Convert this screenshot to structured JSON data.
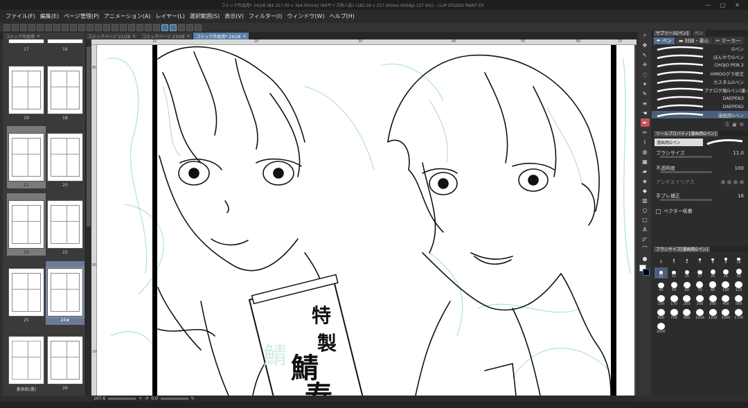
{
  "window": {
    "title": "コミック作品用* 24/28 (B4 257.00 x 364.00mm) (B4サイズ同人誌) (182.00 x 257.00mm 600dpi 107.6%) - CLIP STUDIO PAINT EX",
    "controls": [
      "—",
      "□",
      "✕"
    ]
  },
  "menu": [
    "ファイル(F)",
    "編集(E)",
    "ページ管理(P)",
    "アニメーション(A)",
    "レイヤー(L)",
    "選択範囲(S)",
    "表示(V)",
    "フィルター(I)",
    "ウィンドウ(W)",
    "ヘルプ(H)"
  ],
  "tabs": [
    {
      "label": "コミック作品用",
      "close": "×"
    },
    {
      "label": "コミックページ 21/28",
      "close": "×"
    },
    {
      "label": "コミックページ 23/28",
      "close": "×"
    },
    {
      "label": "コミック作品用* 24/28",
      "close": "×",
      "active": true
    }
  ],
  "pages": [
    {
      "label": "17"
    },
    {
      "label": "16"
    },
    {
      "label": "19"
    },
    {
      "label": "18"
    },
    {
      "label": "21"
    },
    {
      "label": "20"
    },
    {
      "label": "23"
    },
    {
      "label": "22"
    },
    {
      "label": "25"
    },
    {
      "label": "24★"
    },
    {
      "label": "裏表紙(裏)"
    },
    {
      "label": "26"
    }
  ],
  "ruler": {
    "top": [
      "10",
      "20",
      "30",
      "40",
      "50",
      "60",
      "70"
    ],
    "left": [
      "80",
      "90",
      "100"
    ]
  },
  "artwork": {
    "box_text_1": "特",
    "box_text_2": "製",
    "box_text_3": "鯖",
    "box_text_4": "寿",
    "ghost_text": "鯖"
  },
  "status": {
    "zoom": "107.6",
    "angle": "0.0"
  },
  "panels": {
    "subtool_header": [
      "サブツール[ペン]",
      "ペン"
    ],
    "subtool_tabs": [
      "ペン",
      "刻線・書込",
      "マーカー"
    ],
    "brushes": [
      "Gペン",
      "ぼんやりGペン",
      "CHOJO PEN 2",
      "HIMOGゲラ修正",
      "カスタムGペン",
      "アナログ風Gペン(墨っぽい)",
      "DAEPEN3",
      "DAEPEN2",
      "漫画用Gペン"
    ],
    "props_header": "ツールプロパティ[漫画用Gペン]",
    "props_name": "漫画用Gペン",
    "props": [
      {
        "label": "ブラシサイズ",
        "value": "11.0"
      },
      {
        "label": "不透明度",
        "value": "100"
      },
      {
        "label": "アンチエイリアス",
        "value": ""
      },
      {
        "label": "手ブレ補正",
        "value": "16"
      },
      {
        "label": "ベクター吸着",
        "value": ""
      }
    ],
    "size_header": "ブラシサイズ[漫画用Gペン]",
    "sizes": [
      "4",
      "5",
      "6",
      "7",
      "8",
      "9",
      "10",
      "11",
      "12",
      "15",
      "17",
      "20",
      "25",
      "30",
      "40",
      "50",
      "60",
      "70",
      "80",
      "100",
      "120",
      "150",
      "170",
      "200",
      "250",
      "300",
      "400",
      "500",
      "600",
      "700",
      "800",
      "1000",
      "1200",
      "1500",
      "1700",
      "2000"
    ]
  },
  "accent_color": "#546f8e",
  "selected_tool_color": "#c8525c"
}
